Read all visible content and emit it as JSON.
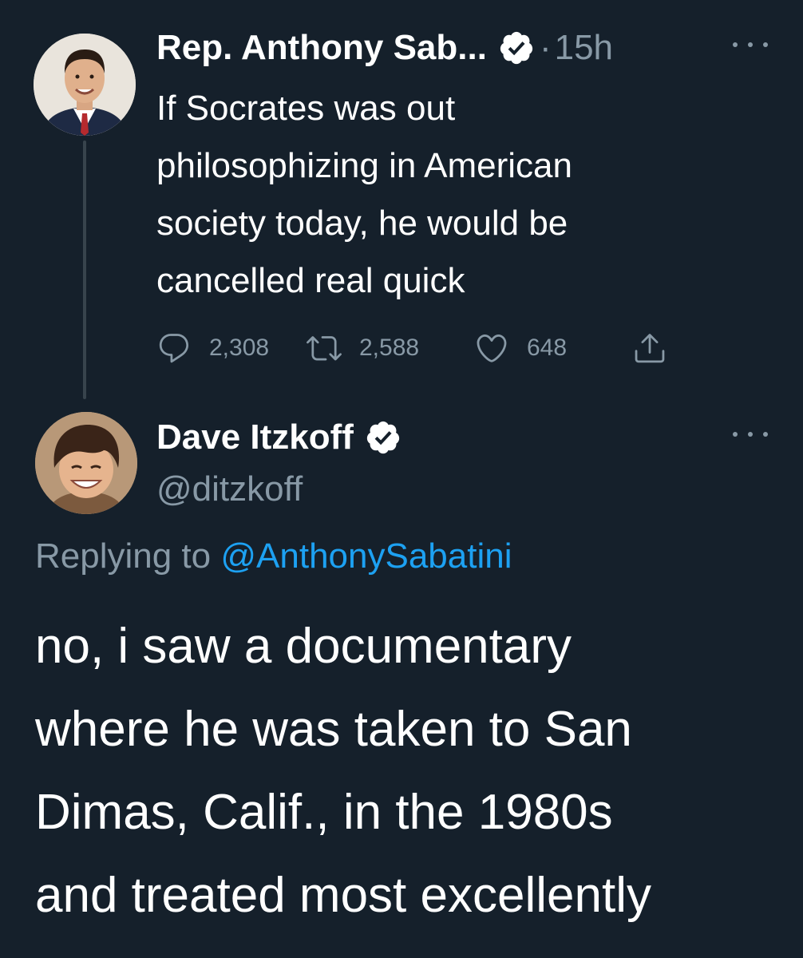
{
  "tweet1": {
    "author_name": "Rep. Anthony Sab...",
    "verified": true,
    "separator": "·",
    "time": "15h",
    "lines": [
      "If Socrates was out",
      "philosophizing in American",
      "society today, he would be",
      "cancelled real quick"
    ],
    "stats": {
      "replies": "2,308",
      "retweets": "2,588",
      "likes": "648"
    }
  },
  "tweet2": {
    "author_name": "Dave Itzkoff",
    "verified": true,
    "handle": "@ditzkoff",
    "replying_prefix": "Replying to ",
    "replying_to": "@AnthonySabatini",
    "lines": [
      "no, i saw a documentary",
      "where he was taken to San",
      "Dimas, Calif., in the 1980s",
      "and treated most excellently"
    ]
  },
  "colors": {
    "background": "#15202b",
    "text_primary": "#ffffff",
    "text_secondary": "#8899a6",
    "link": "#1da1f2",
    "thread_line": "#38444d"
  },
  "icons": {
    "verified": "verified-badge-icon",
    "reply": "reply-icon",
    "retweet": "retweet-icon",
    "like": "heart-icon",
    "share": "share-icon",
    "more": "more-options-icon"
  }
}
